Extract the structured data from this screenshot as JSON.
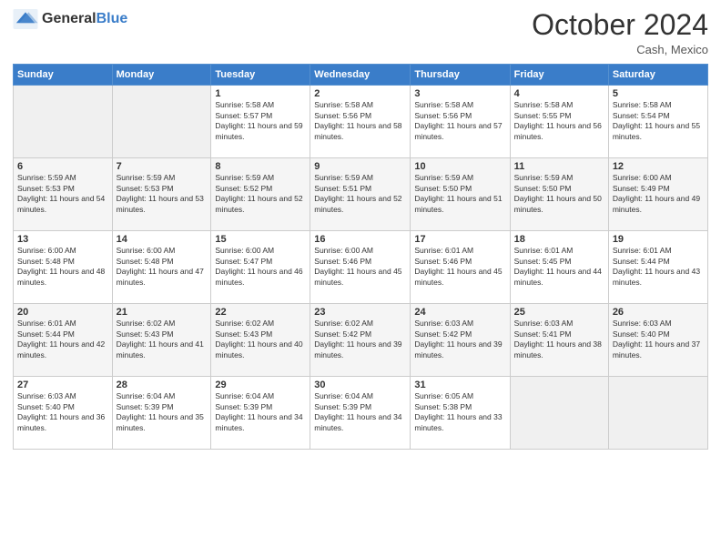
{
  "header": {
    "logo_general": "General",
    "logo_blue": "Blue",
    "month_title": "October 2024",
    "location": "Cash, Mexico"
  },
  "weekdays": [
    "Sunday",
    "Monday",
    "Tuesday",
    "Wednesday",
    "Thursday",
    "Friday",
    "Saturday"
  ],
  "weeks": [
    [
      {
        "day": "",
        "sunrise": "",
        "sunset": "",
        "daylight": "",
        "empty": true
      },
      {
        "day": "",
        "sunrise": "",
        "sunset": "",
        "daylight": "",
        "empty": true
      },
      {
        "day": "1",
        "sunrise": "Sunrise: 5:58 AM",
        "sunset": "Sunset: 5:57 PM",
        "daylight": "Daylight: 11 hours and 59 minutes."
      },
      {
        "day": "2",
        "sunrise": "Sunrise: 5:58 AM",
        "sunset": "Sunset: 5:56 PM",
        "daylight": "Daylight: 11 hours and 58 minutes."
      },
      {
        "day": "3",
        "sunrise": "Sunrise: 5:58 AM",
        "sunset": "Sunset: 5:56 PM",
        "daylight": "Daylight: 11 hours and 57 minutes."
      },
      {
        "day": "4",
        "sunrise": "Sunrise: 5:58 AM",
        "sunset": "Sunset: 5:55 PM",
        "daylight": "Daylight: 11 hours and 56 minutes."
      },
      {
        "day": "5",
        "sunrise": "Sunrise: 5:58 AM",
        "sunset": "Sunset: 5:54 PM",
        "daylight": "Daylight: 11 hours and 55 minutes."
      }
    ],
    [
      {
        "day": "6",
        "sunrise": "Sunrise: 5:59 AM",
        "sunset": "Sunset: 5:53 PM",
        "daylight": "Daylight: 11 hours and 54 minutes."
      },
      {
        "day": "7",
        "sunrise": "Sunrise: 5:59 AM",
        "sunset": "Sunset: 5:53 PM",
        "daylight": "Daylight: 11 hours and 53 minutes."
      },
      {
        "day": "8",
        "sunrise": "Sunrise: 5:59 AM",
        "sunset": "Sunset: 5:52 PM",
        "daylight": "Daylight: 11 hours and 52 minutes."
      },
      {
        "day": "9",
        "sunrise": "Sunrise: 5:59 AM",
        "sunset": "Sunset: 5:51 PM",
        "daylight": "Daylight: 11 hours and 52 minutes."
      },
      {
        "day": "10",
        "sunrise": "Sunrise: 5:59 AM",
        "sunset": "Sunset: 5:50 PM",
        "daylight": "Daylight: 11 hours and 51 minutes."
      },
      {
        "day": "11",
        "sunrise": "Sunrise: 5:59 AM",
        "sunset": "Sunset: 5:50 PM",
        "daylight": "Daylight: 11 hours and 50 minutes."
      },
      {
        "day": "12",
        "sunrise": "Sunrise: 6:00 AM",
        "sunset": "Sunset: 5:49 PM",
        "daylight": "Daylight: 11 hours and 49 minutes."
      }
    ],
    [
      {
        "day": "13",
        "sunrise": "Sunrise: 6:00 AM",
        "sunset": "Sunset: 5:48 PM",
        "daylight": "Daylight: 11 hours and 48 minutes."
      },
      {
        "day": "14",
        "sunrise": "Sunrise: 6:00 AM",
        "sunset": "Sunset: 5:48 PM",
        "daylight": "Daylight: 11 hours and 47 minutes."
      },
      {
        "day": "15",
        "sunrise": "Sunrise: 6:00 AM",
        "sunset": "Sunset: 5:47 PM",
        "daylight": "Daylight: 11 hours and 46 minutes."
      },
      {
        "day": "16",
        "sunrise": "Sunrise: 6:00 AM",
        "sunset": "Sunset: 5:46 PM",
        "daylight": "Daylight: 11 hours and 45 minutes."
      },
      {
        "day": "17",
        "sunrise": "Sunrise: 6:01 AM",
        "sunset": "Sunset: 5:46 PM",
        "daylight": "Daylight: 11 hours and 45 minutes."
      },
      {
        "day": "18",
        "sunrise": "Sunrise: 6:01 AM",
        "sunset": "Sunset: 5:45 PM",
        "daylight": "Daylight: 11 hours and 44 minutes."
      },
      {
        "day": "19",
        "sunrise": "Sunrise: 6:01 AM",
        "sunset": "Sunset: 5:44 PM",
        "daylight": "Daylight: 11 hours and 43 minutes."
      }
    ],
    [
      {
        "day": "20",
        "sunrise": "Sunrise: 6:01 AM",
        "sunset": "Sunset: 5:44 PM",
        "daylight": "Daylight: 11 hours and 42 minutes."
      },
      {
        "day": "21",
        "sunrise": "Sunrise: 6:02 AM",
        "sunset": "Sunset: 5:43 PM",
        "daylight": "Daylight: 11 hours and 41 minutes."
      },
      {
        "day": "22",
        "sunrise": "Sunrise: 6:02 AM",
        "sunset": "Sunset: 5:43 PM",
        "daylight": "Daylight: 11 hours and 40 minutes."
      },
      {
        "day": "23",
        "sunrise": "Sunrise: 6:02 AM",
        "sunset": "Sunset: 5:42 PM",
        "daylight": "Daylight: 11 hours and 39 minutes."
      },
      {
        "day": "24",
        "sunrise": "Sunrise: 6:03 AM",
        "sunset": "Sunset: 5:42 PM",
        "daylight": "Daylight: 11 hours and 39 minutes."
      },
      {
        "day": "25",
        "sunrise": "Sunrise: 6:03 AM",
        "sunset": "Sunset: 5:41 PM",
        "daylight": "Daylight: 11 hours and 38 minutes."
      },
      {
        "day": "26",
        "sunrise": "Sunrise: 6:03 AM",
        "sunset": "Sunset: 5:40 PM",
        "daylight": "Daylight: 11 hours and 37 minutes."
      }
    ],
    [
      {
        "day": "27",
        "sunrise": "Sunrise: 6:03 AM",
        "sunset": "Sunset: 5:40 PM",
        "daylight": "Daylight: 11 hours and 36 minutes."
      },
      {
        "day": "28",
        "sunrise": "Sunrise: 6:04 AM",
        "sunset": "Sunset: 5:39 PM",
        "daylight": "Daylight: 11 hours and 35 minutes."
      },
      {
        "day": "29",
        "sunrise": "Sunrise: 6:04 AM",
        "sunset": "Sunset: 5:39 PM",
        "daylight": "Daylight: 11 hours and 34 minutes."
      },
      {
        "day": "30",
        "sunrise": "Sunrise: 6:04 AM",
        "sunset": "Sunset: 5:39 PM",
        "daylight": "Daylight: 11 hours and 34 minutes."
      },
      {
        "day": "31",
        "sunrise": "Sunrise: 6:05 AM",
        "sunset": "Sunset: 5:38 PM",
        "daylight": "Daylight: 11 hours and 33 minutes."
      },
      {
        "day": "",
        "sunrise": "",
        "sunset": "",
        "daylight": "",
        "empty": true
      },
      {
        "day": "",
        "sunrise": "",
        "sunset": "",
        "daylight": "",
        "empty": true
      }
    ]
  ]
}
